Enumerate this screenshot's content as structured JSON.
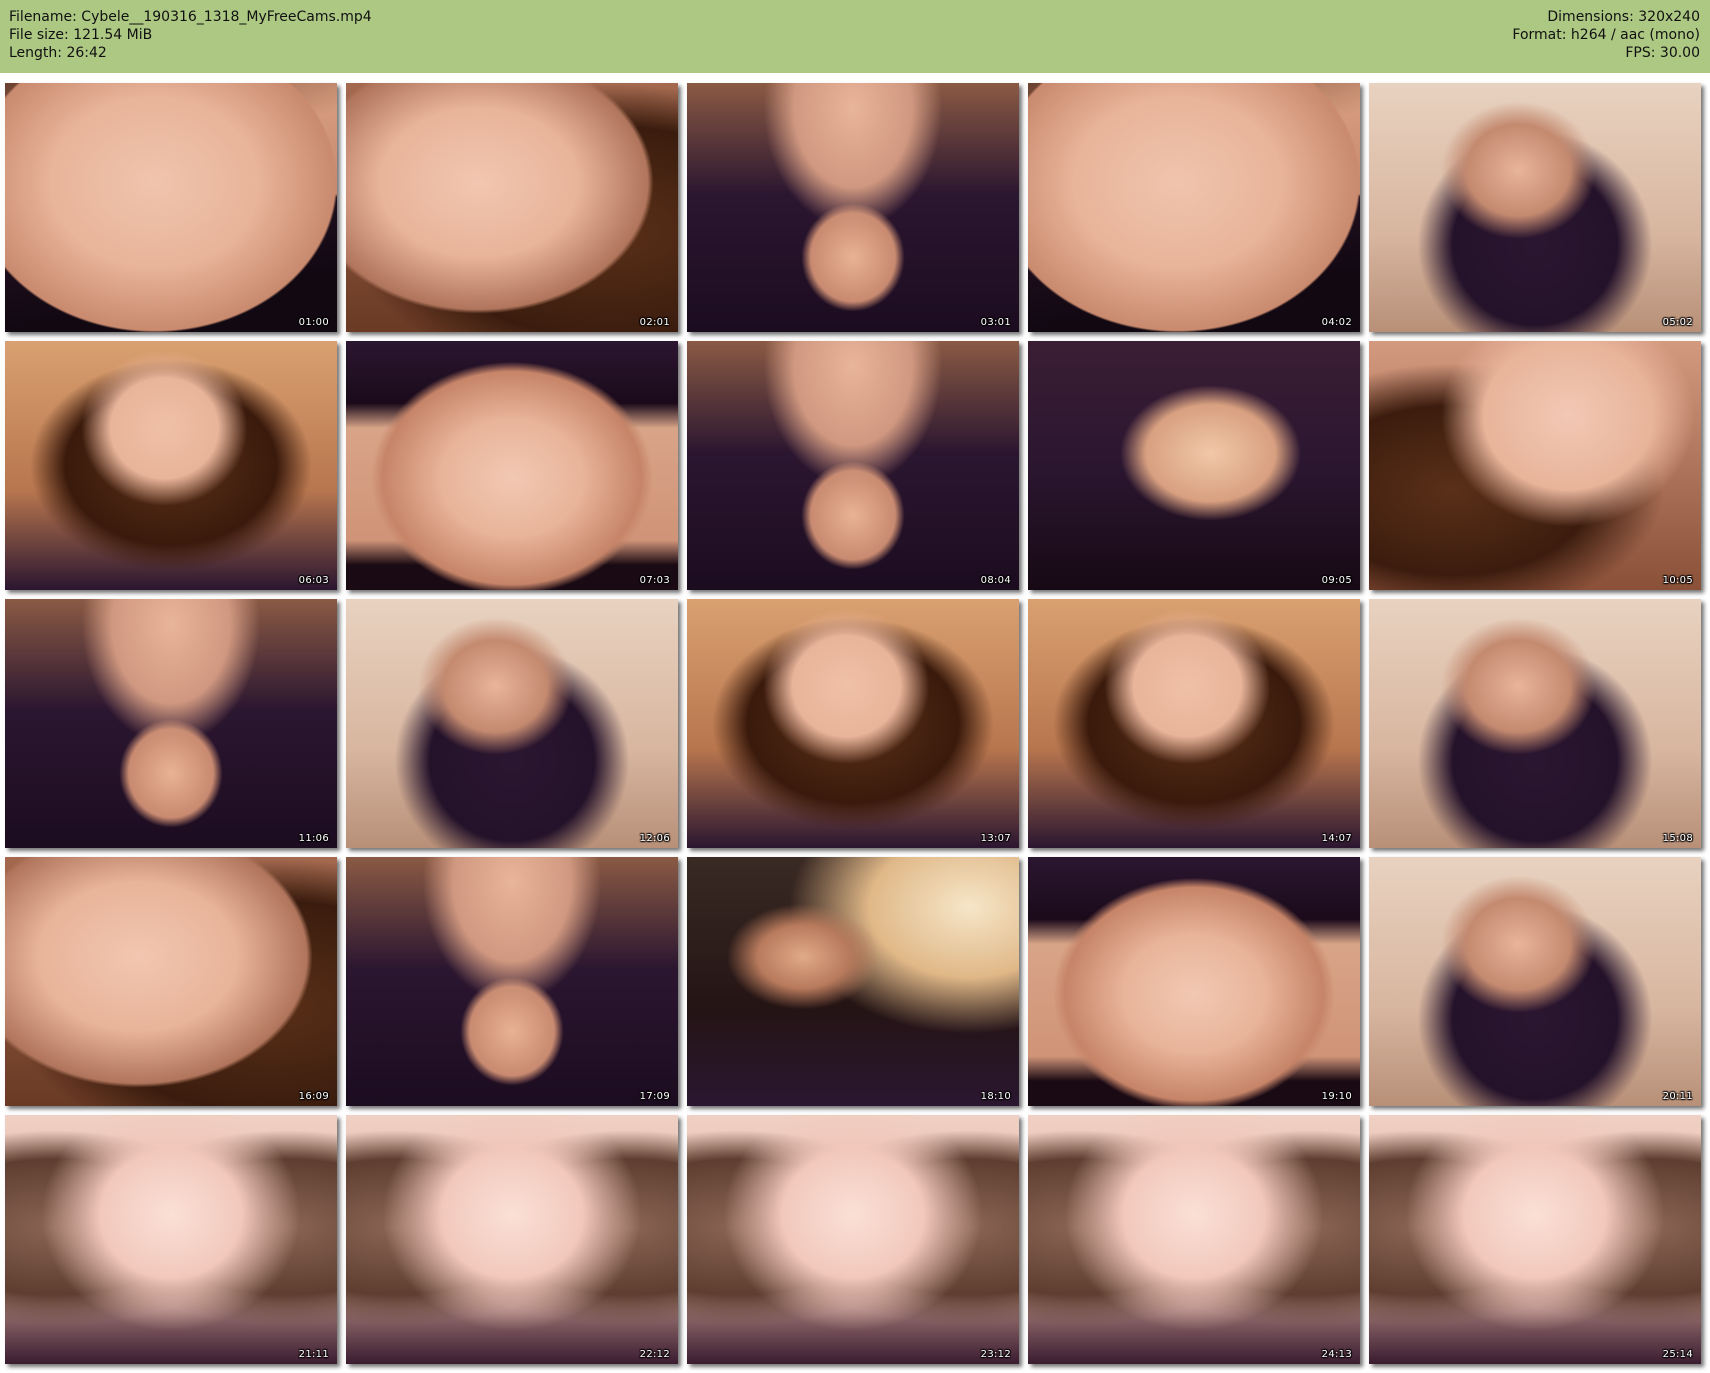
{
  "header": {
    "filename_line": "Filename: Cybele__190316_1318_MyFreeCams.mp4",
    "filesize_line": "File size: 121.54 MiB",
    "length_line": "Length: 26:42",
    "dimensions_line": "Dimensions: 320x240",
    "format_line": "Format: h264 / aac (mono)",
    "fps_line": "FPS: 30.00",
    "background": "#adc883"
  },
  "thumbnails": [
    {
      "time": "01:00",
      "scene": "torso-lingerie"
    },
    {
      "time": "02:01",
      "scene": "face-closeup"
    },
    {
      "time": "03:01",
      "scene": "purple-top"
    },
    {
      "time": "04:02",
      "scene": "torso-lingerie"
    },
    {
      "time": "05:02",
      "scene": "seated-sofa"
    },
    {
      "time": "06:03",
      "scene": "face-hair"
    },
    {
      "time": "07:03",
      "scene": "midriff"
    },
    {
      "time": "08:04",
      "scene": "purple-top"
    },
    {
      "time": "09:05",
      "scene": "hand-chest"
    },
    {
      "time": "10:05",
      "scene": "neck-hair"
    },
    {
      "time": "11:06",
      "scene": "purple-top"
    },
    {
      "time": "12:06",
      "scene": "seated-sofa"
    },
    {
      "time": "13:07",
      "scene": "face-hair"
    },
    {
      "time": "14:07",
      "scene": "face-hair"
    },
    {
      "time": "15:08",
      "scene": "seated-sofa"
    },
    {
      "time": "16:09",
      "scene": "face-closeup"
    },
    {
      "time": "17:09",
      "scene": "purple-top"
    },
    {
      "time": "18:10",
      "scene": "dark-room"
    },
    {
      "time": "19:10",
      "scene": "midriff"
    },
    {
      "time": "20:11",
      "scene": "seated-sofa"
    },
    {
      "time": "21:11",
      "scene": "neckline"
    },
    {
      "time": "22:12",
      "scene": "neckline"
    },
    {
      "time": "23:12",
      "scene": "neckline"
    },
    {
      "time": "24:13",
      "scene": "neckline"
    },
    {
      "time": "25:14",
      "scene": "neckline"
    }
  ],
  "colors": {
    "skin": "#e8b49a",
    "top": "#2b1630",
    "hair": "#5a3018",
    "warm_bg": "#d9a070"
  }
}
